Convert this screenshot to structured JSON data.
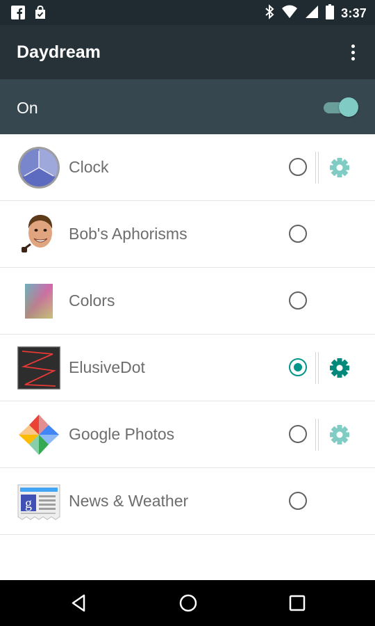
{
  "status_bar": {
    "time": "3:37",
    "icons": [
      "facebook-icon",
      "shopping-bag-icon",
      "bluetooth-icon",
      "wifi-icon",
      "cell-signal-icon",
      "battery-icon"
    ]
  },
  "app_bar": {
    "title": "Daydream",
    "menu_icon": "overflow-menu-icon"
  },
  "master_switch": {
    "label": "On",
    "state": "on"
  },
  "accent_colors": {
    "teal": "#009688",
    "teal_light": "#80cbc4",
    "app_bar": "#263238",
    "switch_bar": "#37474f"
  },
  "daydreams": [
    {
      "label": "Clock",
      "icon": "clock-icon",
      "selected": false,
      "has_settings": true,
      "settings_enabled": false
    },
    {
      "label": "Bob's Aphorisms",
      "icon": "bob-face-icon",
      "selected": false,
      "has_settings": false
    },
    {
      "label": "Colors",
      "icon": "colors-gradient-icon",
      "selected": false,
      "has_settings": false
    },
    {
      "label": "ElusiveDot",
      "icon": "elusivedot-icon",
      "selected": true,
      "has_settings": true,
      "settings_enabled": true
    },
    {
      "label": "Google Photos",
      "icon": "pinwheel-icon",
      "selected": false,
      "has_settings": true,
      "settings_enabled": false
    },
    {
      "label": "News & Weather",
      "icon": "news-weather-icon",
      "selected": false,
      "has_settings": false
    }
  ],
  "nav_bar": {
    "buttons": [
      "back-icon",
      "home-icon",
      "recents-icon"
    ]
  }
}
